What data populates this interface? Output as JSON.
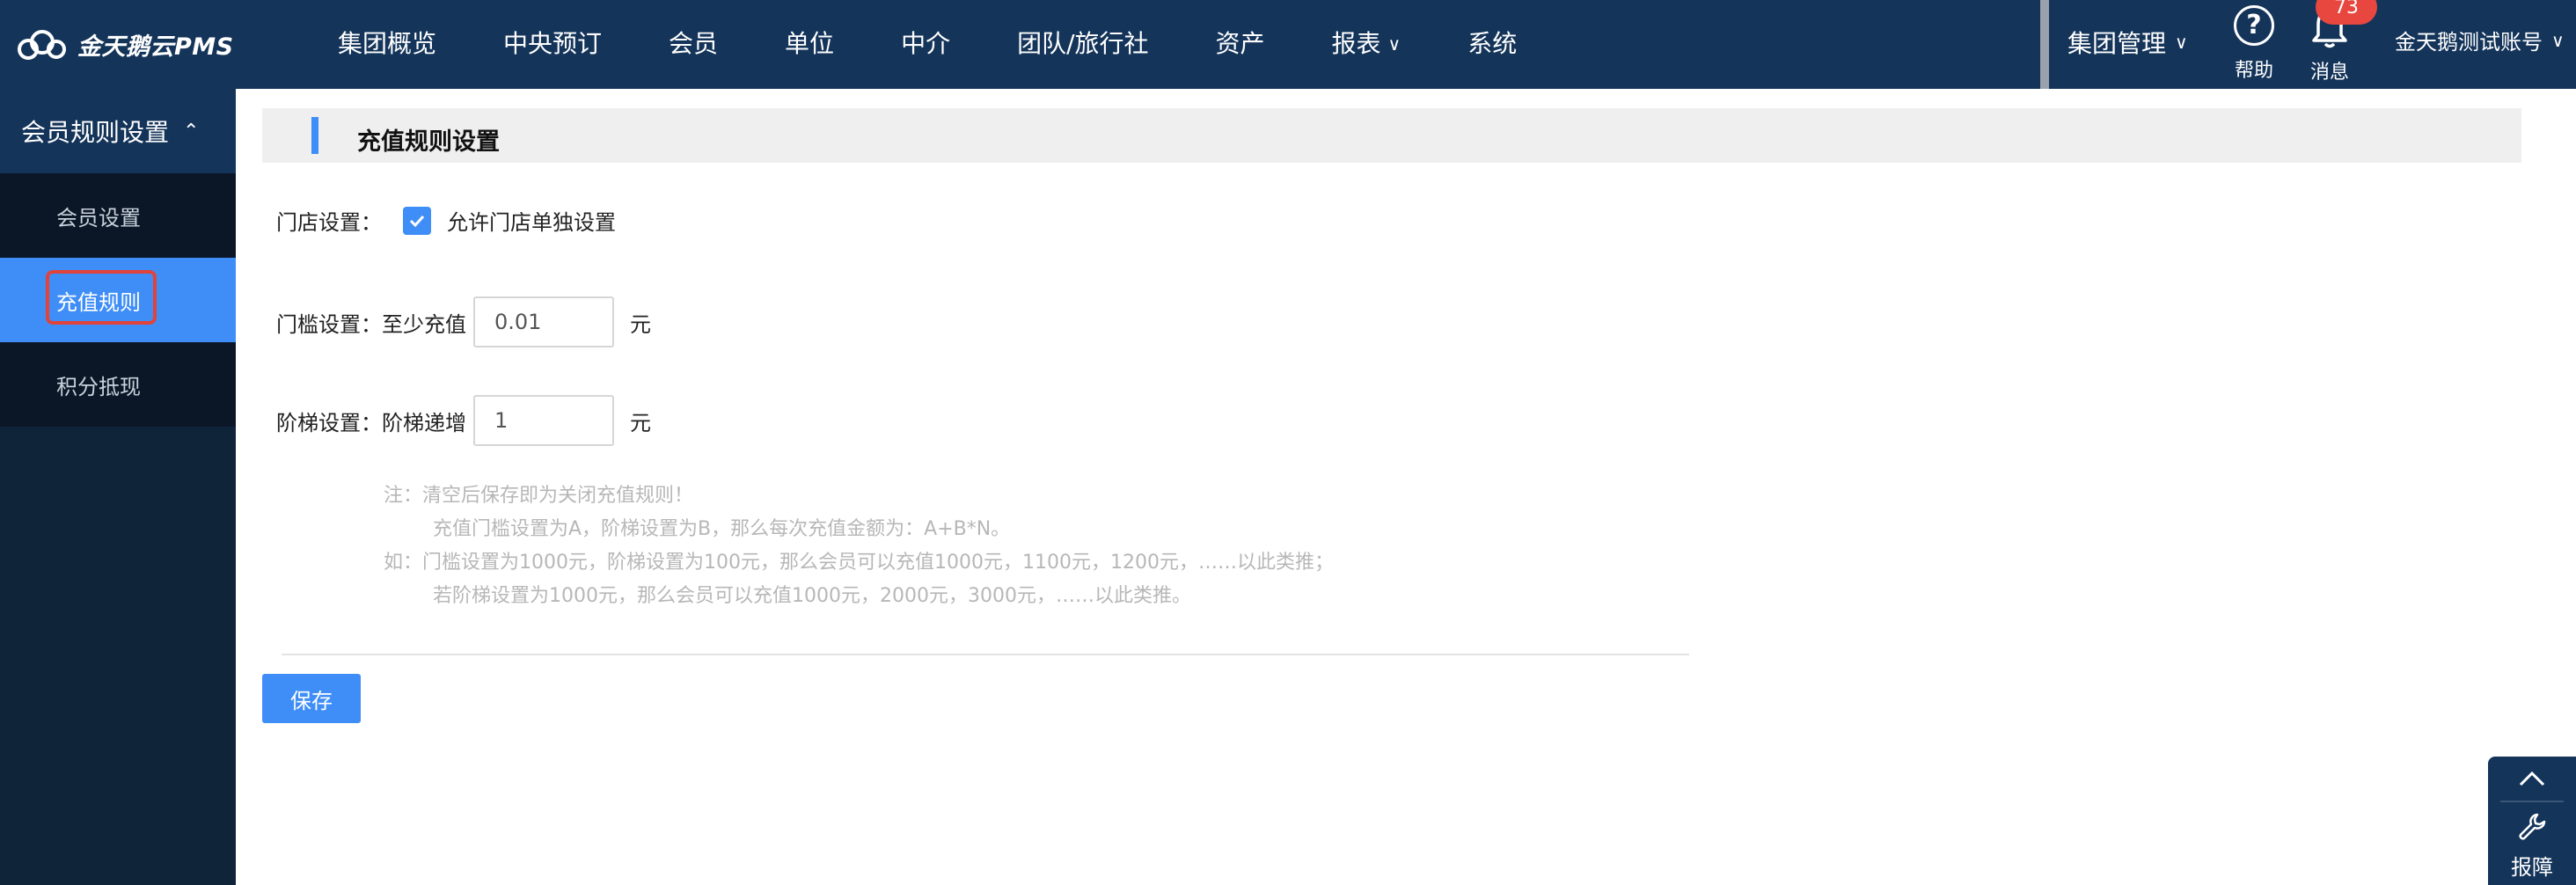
{
  "brand": {
    "name": "金天鹅云PMS"
  },
  "nav": {
    "items": [
      {
        "label": "集团概览",
        "dropdown": false
      },
      {
        "label": "中央预订",
        "dropdown": false
      },
      {
        "label": "会员",
        "dropdown": false
      },
      {
        "label": "单位",
        "dropdown": false
      },
      {
        "label": "中介",
        "dropdown": false
      },
      {
        "label": "团队/旅行社",
        "dropdown": false
      },
      {
        "label": "资产",
        "dropdown": false
      },
      {
        "label": "报表",
        "dropdown": true
      },
      {
        "label": "系统",
        "dropdown": false
      }
    ],
    "group_mgmt": "集团管理",
    "help_label": "帮助",
    "messages_label": "消息",
    "messages_badge": "73",
    "account": "金天鹅测试账号"
  },
  "sidebar": {
    "section": "会员规则设置",
    "items": [
      {
        "label": "会员设置"
      },
      {
        "label": "充值规则"
      },
      {
        "label": "积分抵现"
      }
    ]
  },
  "main": {
    "section_title": "充值规则设置",
    "store": {
      "label": "门店设置：",
      "checkbox_label": "允许门店单独设置",
      "checked": true
    },
    "threshold": {
      "label": "门槛设置：",
      "sublabel": "至少充值",
      "value": "0.01",
      "unit": "元"
    },
    "step": {
      "label": "阶梯设置：",
      "sublabel": "阶梯递增",
      "value": "1",
      "unit": "元"
    },
    "notes": [
      "注：清空后保存即为关闭充值规则！",
      "充值门槛设置为A，阶梯设置为B，那么每次充值金额为：A+B*N。",
      "如：门槛设置为1000元，阶梯设置为100元，那么会员可以充值1000元，1100元，1200元，……以此类推；",
      "若阶梯设置为1000元，那么会员可以充值1000元，2000元，3000元，……以此类推。"
    ],
    "save_label": "保存"
  },
  "float_widget": {
    "report_label": "报障"
  },
  "colors": {
    "topbar": "#14345a",
    "accent": "#3f8ef7",
    "badge": "#e8473f",
    "highlight": "#e0433a"
  }
}
